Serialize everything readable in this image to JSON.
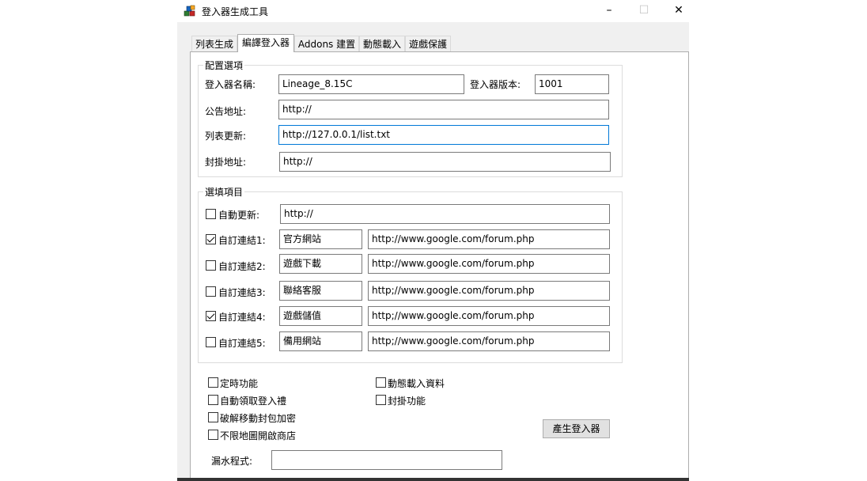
{
  "window": {
    "title": "登入器生成工具",
    "minimize": "–",
    "maximize": "☐",
    "close": "✕"
  },
  "tabs": [
    "列表生成",
    "編譯登入器",
    "Addons 建置",
    "動態載入",
    "遊戲保護"
  ],
  "config": {
    "group_title": "配置選項",
    "name_label": "登入器名稱:",
    "name_value": "Lineage_8.15C",
    "version_label": "登入器版本:",
    "version_value": "1001",
    "notice_label": "公告地址:",
    "notice_value": "http://",
    "list_label": "列表更新:",
    "list_value": "http://127.0.0.1/list.txt",
    "block_label": "封掛地址:",
    "block_value": "http://"
  },
  "options": {
    "group_title": "選填項目",
    "auto_update": {
      "label": "自動更新:",
      "checked": false,
      "value": "http://"
    },
    "links": [
      {
        "label": "自訂連結1:",
        "checked": true,
        "name": "官方網站",
        "url": "http://www.google.com/forum.php"
      },
      {
        "label": "自訂連結2:",
        "checked": false,
        "name": "遊戲下載",
        "url": "http://www.google.com/forum.php"
      },
      {
        "label": "自訂連結3:",
        "checked": false,
        "name": "聯絡客服",
        "url": "http;//www.google.com/forum.php"
      },
      {
        "label": "自訂連結4:",
        "checked": true,
        "name": "遊戲儲值",
        "url": "http;//www.google.com/forum.php"
      },
      {
        "label": "自訂連結5:",
        "checked": false,
        "name": "備用網站",
        "url": "http;//www.google.com/forum.php"
      }
    ]
  },
  "features": {
    "timer": "定時功能",
    "auto_gift": "自動領取登入禮",
    "crack_packet": "破解移動封包加密",
    "unlimited_shop": "不限地圖開啟商店",
    "dynamic_load": "動態載入資料",
    "block_feature": "封掛功能"
  },
  "generate_button": "產生登入器",
  "leak": {
    "label": "漏水程式:",
    "value": ""
  }
}
